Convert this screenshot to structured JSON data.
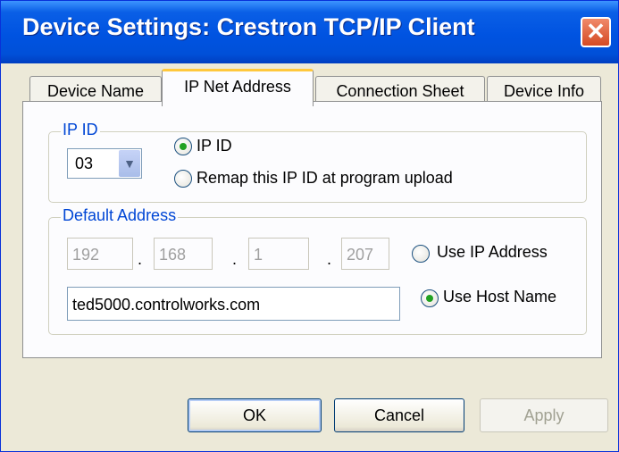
{
  "window": {
    "title": "Device Settings: Crestron TCP/IP Client",
    "close_label": "✕"
  },
  "tabs": [
    {
      "label": "Device Name",
      "active": false
    },
    {
      "label": "IP Net Address",
      "active": true
    },
    {
      "label": "Connection Sheet",
      "active": false
    },
    {
      "label": "Device Info",
      "active": false
    }
  ],
  "ip_id_group": {
    "legend": "IP ID",
    "combo_value": "03",
    "options": [
      {
        "label": "IP ID",
        "selected": true
      },
      {
        "label": "Remap this IP ID at program upload",
        "selected": false
      }
    ]
  },
  "default_address_group": {
    "legend": "Default Address",
    "ip_octets": [
      "192",
      "168",
      "1",
      "207"
    ],
    "separator": ".",
    "use_ip_label": "Use IP Address",
    "use_ip_selected": false,
    "host_name": "ted5000.controlworks.com",
    "use_host_label": "Use Host Name",
    "use_host_selected": true
  },
  "buttons": {
    "ok": "OK",
    "cancel": "Cancel",
    "apply": "Apply"
  },
  "colors": {
    "titlebar": "#0053e1",
    "legend_text": "#0046d5",
    "radio_selected": "#21a121",
    "active_tab_accent": "#ffc83c"
  }
}
